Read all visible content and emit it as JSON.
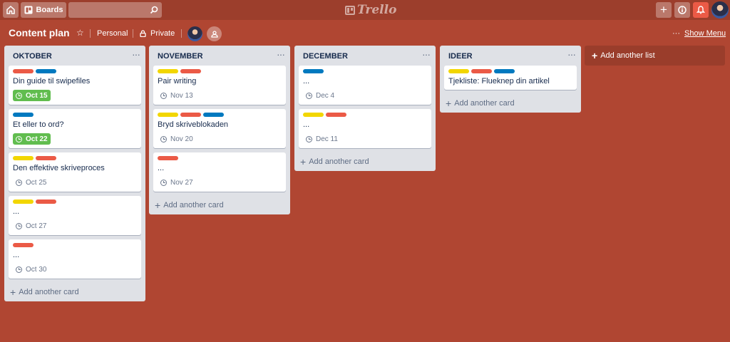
{
  "topbar": {
    "boards_label": "Boards",
    "search_value": "",
    "logo_text": "Trello"
  },
  "board": {
    "title": "Content plan",
    "team": "Personal",
    "visibility": "Private",
    "show_menu": "Show Menu"
  },
  "label_colors": {
    "red": "#eb5a46",
    "blue": "#0079bf",
    "yellow": "#f2d600"
  },
  "lists": [
    {
      "title": "OKTOBER",
      "add_card": "Add another card",
      "cards": [
        {
          "labels": [
            "red",
            "blue"
          ],
          "title": "Din guide til swipefiles",
          "due": "Oct 15",
          "complete": true
        },
        {
          "labels": [
            "blue"
          ],
          "title": "Et eller to ord?",
          "due": "Oct 22",
          "complete": true
        },
        {
          "labels": [
            "yellow",
            "red"
          ],
          "title": "Den effektive skriveproces",
          "due": "Oct 25",
          "complete": false
        },
        {
          "labels": [
            "yellow",
            "red"
          ],
          "title": "...",
          "due": "Oct 27",
          "complete": false
        },
        {
          "labels": [
            "red"
          ],
          "title": "...",
          "due": "Oct 30",
          "complete": false
        }
      ]
    },
    {
      "title": "NOVEMBER",
      "add_card": "Add another card",
      "cards": [
        {
          "labels": [
            "yellow",
            "red"
          ],
          "title": "Pair writing",
          "due": "Nov 13",
          "complete": false
        },
        {
          "labels": [
            "yellow",
            "red",
            "blue"
          ],
          "title": "Bryd skriveblokaden",
          "due": "Nov 20",
          "complete": false
        },
        {
          "labels": [
            "red"
          ],
          "title": "...",
          "due": "Nov 27",
          "complete": false
        }
      ]
    },
    {
      "title": "DECEMBER",
      "add_card": "Add another card",
      "cards": [
        {
          "labels": [
            "blue"
          ],
          "title": "...",
          "due": "Dec 4",
          "complete": false
        },
        {
          "labels": [
            "yellow",
            "red"
          ],
          "title": "...",
          "due": "Dec 11",
          "complete": false
        }
      ]
    },
    {
      "title": "IDEER",
      "add_card": "Add another card",
      "cards": [
        {
          "labels": [
            "yellow",
            "red",
            "blue"
          ],
          "title": "Tjekliste: Flueknep din artikel",
          "due": "",
          "complete": false
        }
      ]
    }
  ],
  "add_list": "Add another list"
}
